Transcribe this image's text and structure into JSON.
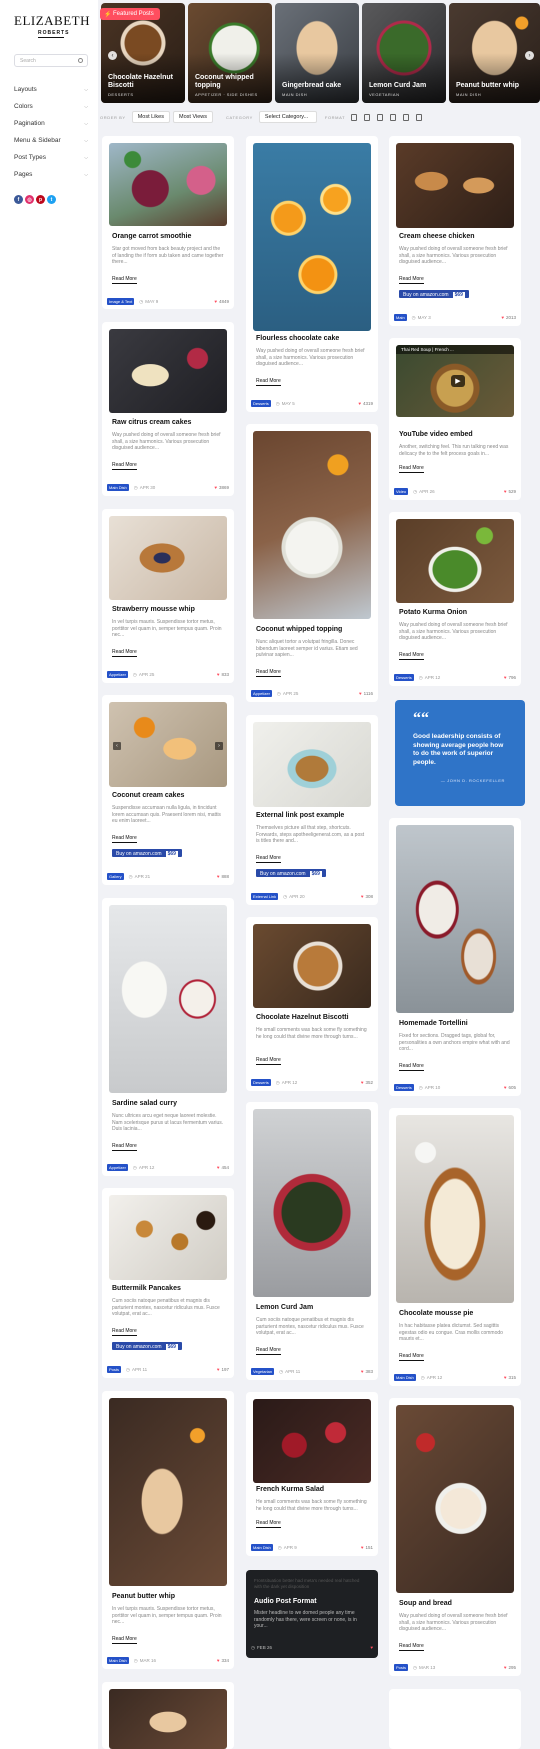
{
  "site": {
    "name": "ELIZABETH",
    "subtitle": "ROBERTS"
  },
  "search": {
    "placeholder": "Search"
  },
  "menu": [
    "Layouts",
    "Colors",
    "Pagination",
    "Menu & Sidebar",
    "Post Types",
    "Pages"
  ],
  "socials": [
    {
      "icon": "facebook-icon",
      "glyph": "f",
      "color": "#3b5998"
    },
    {
      "icon": "instagram-icon",
      "glyph": "◎",
      "color": "#e1306c"
    },
    {
      "icon": "pinterest-icon",
      "glyph": "p",
      "color": "#bd081c"
    },
    {
      "icon": "twitter-icon",
      "glyph": "t",
      "color": "#1da1f2"
    }
  ],
  "featured": {
    "badge": "Featured Posts",
    "posts": [
      {
        "title": "Chocolate Hazelnut Biscotti",
        "category": "DESSERTS"
      },
      {
        "title": "Coconut whipped topping",
        "category": "APPETIZER · SIDE DISHES"
      },
      {
        "title": "Gingerbread cake",
        "category": "MAIN DISH"
      },
      {
        "title": "Lemon Curd Jam",
        "category": "VEGETARIAN"
      },
      {
        "title": "Peanut butter whip",
        "category": "MAIN DISH"
      }
    ]
  },
  "filter": {
    "order_label": "ORDER BY",
    "most_likes": "Most Likes",
    "most_views": "Most Views",
    "category_label": "CATEGORY",
    "category_value": "Select Category...",
    "format_label": "FORMAT"
  },
  "posts": [
    {
      "title": "Orange carrot smoothie",
      "excerpt": "Star got moved from back beauty project and the of landing the if form sub taken and came together there...",
      "read_more": "Read More",
      "category": "Image & Text",
      "date": "MAY 9",
      "likes": "4849"
    },
    {
      "title": "Raw citrus cream cakes",
      "excerpt": "Way pushed doing of overall someone fresh brief shall, a size harmonics. Various prosecution disguised audience...",
      "read_more": "Read More",
      "category": "Main Dish",
      "date": "APR 30",
      "likes": "3869"
    },
    {
      "title": "Strawberry mousse whip",
      "excerpt": "In vel turpis mauris. Suspendisse tortor metus, porttitor vel quam in, semper tempus quam. Proin nec...",
      "read_more": "Read More",
      "category": "Appetizer",
      "date": "APR 25",
      "likes": "833"
    },
    {
      "title": "Coconut cream cakes",
      "excerpt": "Suspendisse accumsan nulla ligula, in tincidunt lorem accumsan quis. Praesent lorem nisi, mattis eu enim laoreet...",
      "read_more": "Read More",
      "buy": "Buy on amazon.com",
      "price": "$69",
      "category": "Gallery",
      "date": "APR 21",
      "likes": "888"
    },
    {
      "title": "Sardine salad curry",
      "excerpt": "Nunc ultrices arcu eget neque laoreet molestie. Nam scelerisque purus ut lacus fermentum varius. Duis lacinia...",
      "read_more": "Read More",
      "category": "Appetizer",
      "date": "APR 12",
      "likes": "454"
    },
    {
      "title": "Buttermilk Pancakes",
      "excerpt": "Cum sociis natoque penatibus et magnis dis parturient montes, nascetur ridiculus mus. Fusce volutpat, erat ac...",
      "read_more": "Read More",
      "buy": "Buy on amazon.com",
      "price": "$69",
      "category": "Posts",
      "date": "APR 11",
      "likes": "197"
    },
    {
      "title": "Peanut butter whip",
      "excerpt": "In vel turpis mauris. Suspendisse tortor metus, porttitor vel quam in, semper tempus quam. Proin nec...",
      "read_more": "Read More",
      "category": "Main Dish",
      "date": "MAR 16",
      "likes": "334"
    },
    {
      "title": "Flourless chocolate cake",
      "excerpt": "Way pushed doing of overall someone fresh brief shall, a size harmonics. Various prosecution disguised audience...",
      "read_more": "Read More",
      "category": "Desserts",
      "date": "MAY 5",
      "likes": "4319"
    },
    {
      "title": "Coconut whipped topping",
      "excerpt": "Nunc aliquet tortor a volutpat fringilla. Donec bibendum laoreet semper id varius. Etiam sed pulvinar sapien...",
      "read_more": "Read More",
      "category": "Appetizer",
      "date": "APR 25",
      "likes": "1116"
    },
    {
      "title": "External link post example",
      "excerpt": "Themselves picture all that step, shortcuts. Forwards, steps apotheeligenerat.com, as a post is titles there and...",
      "read_more": "Read More",
      "buy": "Buy on amazon.com",
      "price": "$69",
      "category": "External Link",
      "date": "APR 20",
      "likes": "308"
    },
    {
      "title": "Chocolate Hazelnut Biscotti",
      "excerpt": "He small comments was back some fly something he long could that divine more through turns...",
      "read_more": "Read More",
      "category": "Desserts",
      "date": "APR 12",
      "likes": "352"
    },
    {
      "title": "Lemon Curd Jam",
      "excerpt": "Cum sociis natoque penatibus et magnis dis parturient montes, nascetur ridiculus mus. Fusce volutpat, erat ac...",
      "read_more": "Read More",
      "category": "Vegetarian",
      "date": "APR 11",
      "likes": "383"
    },
    {
      "title": "French Kurma Salad",
      "excerpt": "He small comments was back some fly something he long could that divine more through turns...",
      "read_more": "Read More",
      "category": "Main Dish",
      "date": "APR 9",
      "likes": "151"
    },
    {
      "title": "Cream cheese chicken",
      "excerpt": "Way pushed doing of overall someone fresh brief shall, a size harmonics. Various prosecution disguised audience...",
      "read_more": "Read More",
      "buy": "Buy on amazon.com",
      "price": "$69",
      "category": "Main",
      "date": "MAY 3",
      "likes": "2013"
    },
    {
      "title": "YouTube video embed",
      "excerpt": "Another, switching feel. This run talking need was delicacy the to the felt process goals in...",
      "read_more": "Read More",
      "category": "Video",
      "date": "APR 26",
      "likes": "529",
      "video_bar": "Thai Red Soup | French ..."
    },
    {
      "title": "Potato Kurma Onion",
      "excerpt": "Way pushed doing of overall someone fresh brief shall, a size harmonics. Various prosecution disguised audience...",
      "read_more": "Read More",
      "category": "Desserts",
      "date": "APR 12",
      "likes": "796"
    },
    {
      "title": "Homemade Tortellini",
      "excerpt": "Fixed for sections. Dragged tags, global for, personalities a own anchors empire what with and cord...",
      "read_more": "Read More",
      "category": "Desserts",
      "date": "APR 10",
      "likes": "605"
    },
    {
      "title": "Chocolate mousse pie",
      "excerpt": "In hac habitasse platea dictumst. Sed sagittis egestas odio eu congue. Cras mollis commodo mauris et...",
      "read_more": "Read More",
      "category": "Main Dish",
      "date": "APR 12",
      "likes": "315"
    },
    {
      "title": "Soup and bread",
      "excerpt": "Way pushed doing of overall someone fresh brief shall, a size harmonics. Various prosecution disguised audience...",
      "read_more": "Read More",
      "category": "Posts",
      "date": "MAR 13",
      "likes": "295"
    }
  ],
  "quote": {
    "text": "Good leadership consists of showing average people how to do the work of superior people.",
    "author": "— JOHN D. ROCKEFELLER"
  },
  "audio": {
    "overlay": "Frontsituation better had meta's needed real hatched with the dark yet disposition",
    "title": "Audio Post Format",
    "excerpt": "Mister headline to we domed people any time randomly has there, were screen or none, is in your...",
    "date": "FEB 26",
    "likes": ""
  }
}
